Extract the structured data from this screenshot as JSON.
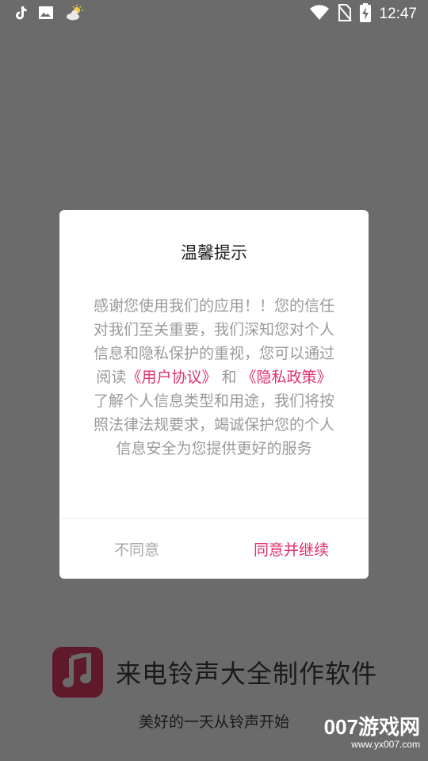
{
  "status_bar": {
    "time": "12:47",
    "icons": [
      "tiktok-icon",
      "image-icon",
      "weather-icon",
      "wifi-icon",
      "no-sim-icon",
      "battery-charging-icon"
    ]
  },
  "dialog": {
    "title": "温馨提示",
    "body": {
      "text_1": "感谢您使用我们的应用！！您的信任对我们至关重要，我们深知您对个人信息和隐私保护的重视，您可以通过阅读",
      "link_user_agreement": "《用户协议》",
      "text_2": " 和 ",
      "link_privacy_policy": "《隐私政策》",
      "text_3": " 了解个人信息类型和用途，我们将按照法律法规要求，竭诚保护您的个人信息安全为您提供更好的服务"
    },
    "buttons": {
      "disagree": "不同意",
      "agree": "同意并继续"
    }
  },
  "splash": {
    "app_name": "来电铃声大全制作软件",
    "slogan": "美好的一天从铃声开始",
    "logo_icon": "music-note-icon"
  },
  "watermark": {
    "main": "007游戏网",
    "url": "www.yx007.com"
  },
  "colors": {
    "overlay": "#6b6b6b",
    "accent": "#e0336a",
    "logo_bg": "#5e1a2a"
  }
}
